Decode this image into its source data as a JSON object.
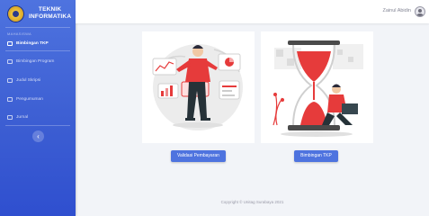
{
  "brand": {
    "line1": "TEKNIK",
    "line2": "INFORMATIKA"
  },
  "sidebar": {
    "section_label": "MAHASISWA",
    "items": [
      {
        "label": "Bimbingan TKP",
        "active": true
      },
      {
        "label": "Bimbingan Program",
        "active": false
      },
      {
        "label": "Judul Skripsi",
        "active": false
      },
      {
        "label": "Pengumuman",
        "active": false
      },
      {
        "label": "Jurnal",
        "active": false
      }
    ],
    "toggle_label": "‹"
  },
  "topbar": {
    "username": "Zainul Abidin"
  },
  "cards": [
    {
      "button_label": "Validasi Pembayaran"
    },
    {
      "button_label": "Bimbingan TKP"
    }
  ],
  "footer": {
    "text": "Copyright © Unitag Surabaya 2021"
  },
  "colors": {
    "primary": "#4e73df",
    "accent_red": "#e63b3b",
    "background": "#f2f4f8"
  }
}
